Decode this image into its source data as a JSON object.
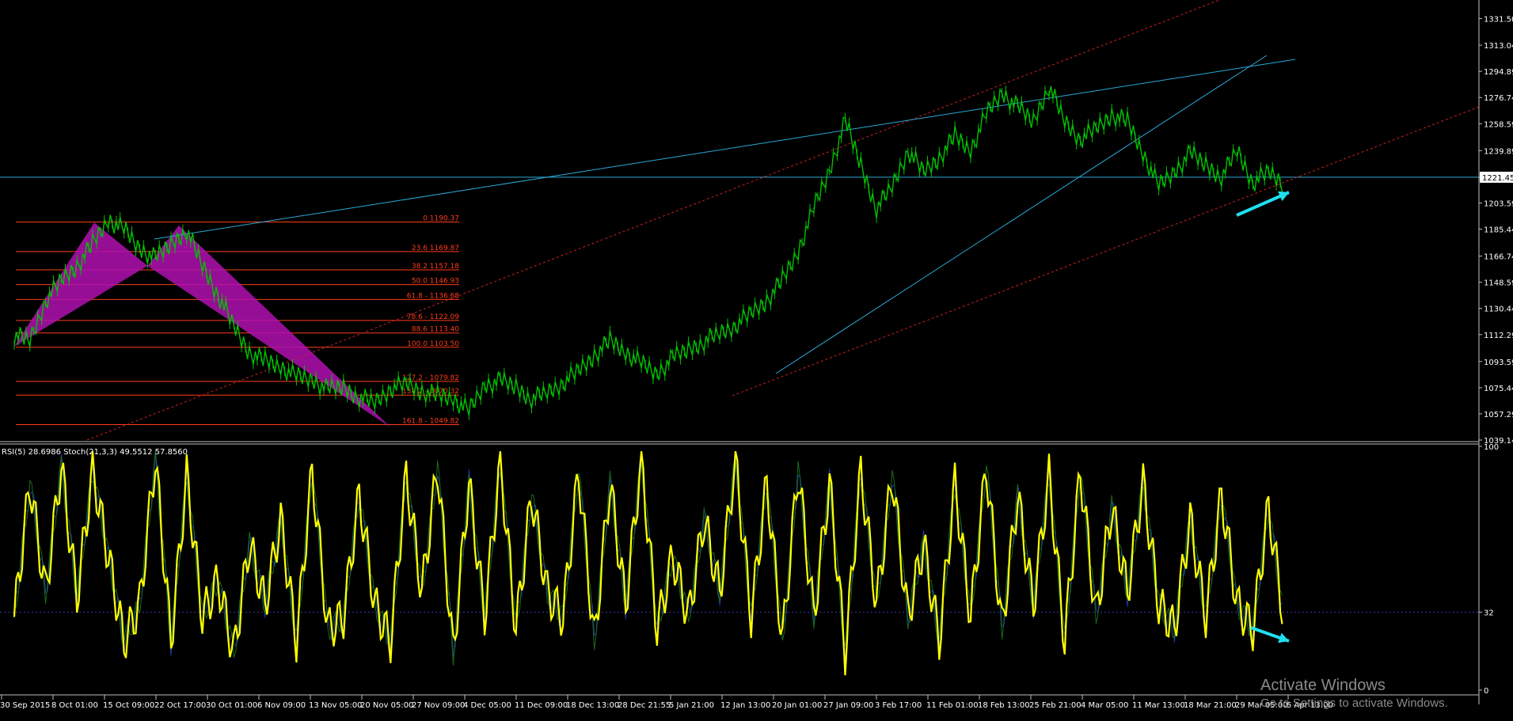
{
  "indicator_label": "RSI(5) 28.6986   Stoch(21,3,3) 49.5512 57.8560",
  "watermark": {
    "title": "Activate Windows",
    "subtitle": "Go to Settings to activate Windows."
  },
  "colors": {
    "background": "#000000",
    "price": "#00c000",
    "trendline": "#2aa9d6",
    "channel": "#d02020",
    "fib": "#ff3c1a",
    "pattern": "#b010b0",
    "rsi": "#ffff00",
    "stoch_main": "#1a3aa0",
    "stoch_signal": "#1a6a1a",
    "arrow": "#1ee0f0"
  },
  "current_price": "1221.45",
  "chart_data": [
    {
      "type": "line",
      "name": "price",
      "ylim": [
        1039.14,
        1340
      ],
      "y_ticks": [
        "1331.50",
        "1313.04",
        "1294.89",
        "1276.74",
        "1258.59",
        "1239.89",
        "1221.45",
        "1203.59",
        "1185.44",
        "1166.74",
        "1148.59",
        "1130.44",
        "1112.29",
        "1093.59",
        "1075.44",
        "1057.29",
        "1039.14"
      ],
      "x_ticks": [
        "30 Sep 2015",
        "8 Oct 01:00",
        "15 Oct 09:00",
        "22 Oct 17:00",
        "30 Oct 01:00",
        "6 Nov 09:00",
        "13 Nov 05:00",
        "20 Nov 05:00",
        "27 Nov 09:00",
        "4 Dec 05:00",
        "11 Dec 09:00",
        "18 Dec 13:00",
        "28 Dec 21:55",
        "5 Jan 21:00",
        "12 Jan 13:00",
        "20 Jan 01:00",
        "27 Jan 09:00",
        "3 Feb 17:00",
        "11 Feb 01:00",
        "18 Feb 13:00",
        "25 Feb 21:00",
        "4 Mar 05:00",
        "11 Mar 13:00",
        "18 Mar 21:00",
        "29 Mar 05:00",
        "5 Apr 13:00"
      ],
      "x": [
        0,
        20,
        40,
        60,
        80,
        100,
        120,
        140,
        160,
        180,
        200,
        220,
        240,
        260,
        280,
        300,
        320,
        340,
        360,
        380,
        400,
        420,
        440,
        460,
        480,
        500,
        520,
        540,
        560,
        580,
        600,
        620,
        640,
        660,
        680,
        700,
        720,
        740,
        760,
        780,
        800,
        820,
        840,
        860,
        880,
        900,
        920,
        940,
        960,
        980,
        1000,
        1020,
        1040,
        1060,
        1080,
        1100,
        1120,
        1140,
        1160,
        1180,
        1200,
        1220,
        1240,
        1260,
        1280,
        1300,
        1320,
        1340,
        1360,
        1380,
        1400,
        1420,
        1440,
        1460,
        1480,
        1500,
        1520,
        1540,
        1560,
        1580,
        1600,
        1620
      ],
      "y": [
        1112,
        1108,
        1136,
        1150,
        1160,
        1175,
        1192,
        1185,
        1172,
        1165,
        1175,
        1185,
        1160,
        1140,
        1118,
        1100,
        1094,
        1090,
        1083,
        1081,
        1074,
        1076,
        1069,
        1065,
        1075,
        1078,
        1073,
        1070,
        1068,
        1059,
        1077,
        1080,
        1076,
        1068,
        1072,
        1079,
        1087,
        1098,
        1108,
        1100,
        1092,
        1085,
        1096,
        1102,
        1108,
        1113,
        1119,
        1127,
        1136,
        1150,
        1170,
        1200,
        1226,
        1260,
        1230,
        1200,
        1215,
        1240,
        1225,
        1235,
        1250,
        1240,
        1265,
        1280,
        1270,
        1260,
        1285,
        1260,
        1248,
        1255,
        1265,
        1260,
        1238,
        1215,
        1225,
        1238,
        1230,
        1222,
        1240,
        1218,
        1225,
        1217
      ],
      "fib_levels": [
        {
          "label": "0 1190.37",
          "price": 1190.37
        },
        {
          "label": "23.6 1169.87",
          "price": 1169.87
        },
        {
          "label": "38.2 1157.18",
          "price": 1157.18
        },
        {
          "label": "50.0 1146.93",
          "price": 1146.93
        },
        {
          "label": "61.8 - 1136.68",
          "price": 1136.68
        },
        {
          "label": "78.6 - 1122.09",
          "price": 1122.09
        },
        {
          "label": "88.6 1113.40",
          "price": 1113.4
        },
        {
          "label": "100.0 1103.50",
          "price": 1103.5
        },
        {
          "label": "127.2 - 1079.82",
          "price": 1079.82
        },
        {
          "label": "138.2 - 1070.32",
          "price": 1070.32
        },
        {
          "label": "161.8 - 1049.82",
          "price": 1049.82
        }
      ]
    },
    {
      "type": "line",
      "name": "RSI(5)",
      "ylim": [
        0,
        100
      ],
      "y_ticks": [
        "100",
        "32",
        "0"
      ],
      "level": 32,
      "x": [
        0,
        20,
        40,
        60,
        80,
        100,
        120,
        140,
        160,
        180,
        200,
        220,
        240,
        260,
        280,
        300,
        320,
        340,
        360,
        380,
        400,
        420,
        440,
        460,
        480,
        500,
        520,
        540,
        560,
        580,
        600,
        620,
        640,
        660,
        680,
        700,
        720,
        740,
        760,
        780,
        800,
        820,
        840,
        860,
        880,
        900,
        920,
        940,
        960,
        980,
        1000,
        1020,
        1040,
        1060,
        1080,
        1100,
        1120,
        1140,
        1160,
        1180,
        1200,
        1220,
        1240,
        1260,
        1280,
        1300,
        1320,
        1340,
        1360,
        1380,
        1400,
        1420,
        1440,
        1460,
        1480,
        1500,
        1520,
        1540,
        1560,
        1580,
        1600,
        1620
      ],
      "values": [
        30,
        85,
        40,
        92,
        38,
        90,
        55,
        20,
        35,
        95,
        20,
        88,
        30,
        45,
        15,
        60,
        35,
        70,
        20,
        90,
        25,
        30,
        80,
        35,
        20,
        88,
        40,
        92,
        15,
        85,
        30,
        94,
        25,
        80,
        40,
        30,
        90,
        20,
        85,
        35,
        95,
        25,
        55,
        30,
        70,
        40,
        95,
        30,
        85,
        20,
        90,
        30,
        85,
        15,
        90,
        35,
        88,
        30,
        60,
        20,
        85,
        30,
        92,
        25,
        80,
        35,
        88,
        20,
        90,
        30,
        75,
        40,
        85,
        35,
        25,
        70,
        30,
        80,
        35,
        25,
        75,
        28
      ]
    }
  ]
}
